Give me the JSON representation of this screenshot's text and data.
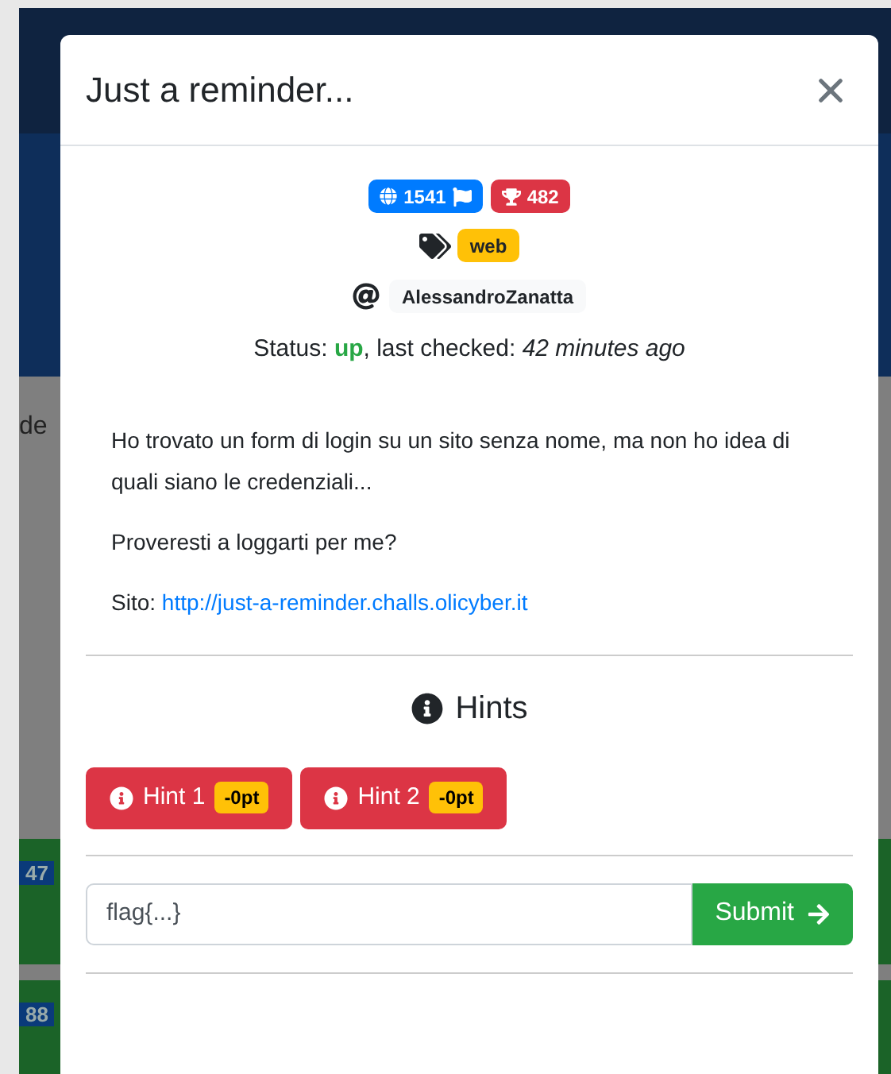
{
  "background": {
    "fragments": [
      {
        "text": "de",
        "kind": "text"
      },
      {
        "text": "47",
        "kind": "badge"
      },
      {
        "text": "88",
        "kind": "badge"
      }
    ]
  },
  "modal": {
    "title": "Just a reminder...",
    "badges": [
      {
        "text": "1541",
        "kind": "solves"
      },
      {
        "text": "482",
        "kind": "points"
      }
    ],
    "tags": [
      "web"
    ],
    "author": "AlessandroZanatta",
    "status": {
      "label": "Status: ",
      "value": "up",
      "up": true,
      "checked_label": ", last checked: ",
      "checked_time": "42 minutes ago"
    },
    "description": [
      "Ho trovato un form di login su un sito senza nome, ma non ho idea di quali siano le credenziali...",
      "Proveresti a loggarti per me?"
    ],
    "site": {
      "label": "Sito: ",
      "url": "http://just-a-reminder.challs.olicyber.it"
    },
    "hints_title": "Hints",
    "hints": [
      {
        "label": "Hint 1",
        "cost": "-0pt"
      },
      {
        "label": "Hint 2",
        "cost": "-0pt"
      }
    ],
    "flag_input": {
      "placeholder": "flag{...}"
    },
    "submit": "Submit"
  }
}
